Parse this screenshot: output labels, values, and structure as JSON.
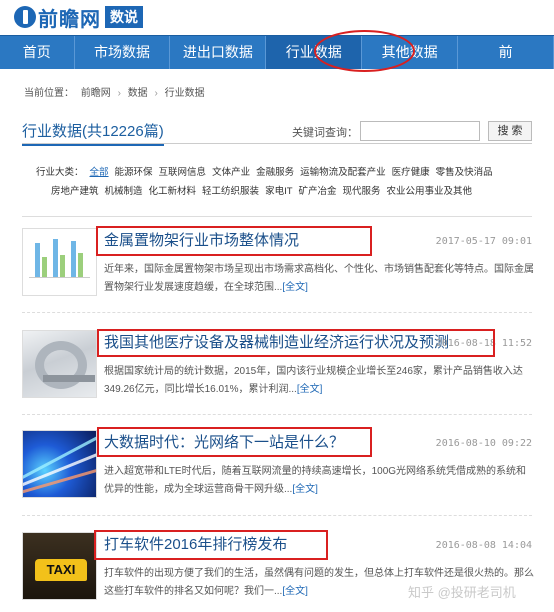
{
  "logo": {
    "name": "前瞻网",
    "badge": "数说"
  },
  "nav": [
    "首页",
    "市场数据",
    "进出口数据",
    "行业数据",
    "其他数据",
    "前"
  ],
  "breadcrumb": {
    "label": "当前位置：",
    "items": [
      "前瞻网",
      "数据",
      "行业数据"
    ]
  },
  "section": {
    "title": "行业数据(共12226篇)",
    "keyword_label": "关键词查询：",
    "search_value": "",
    "search_button": "搜 索"
  },
  "categories": {
    "label": "行业大类：",
    "row1": [
      "全部",
      "能源环保",
      "互联网信息",
      "文体产业",
      "金融服务",
      "运输物流及配套产业",
      "医疗健康",
      "零售及快消品"
    ],
    "row2": [
      "房地产建筑",
      "机械制造",
      "化工新材料",
      "轻工纺织服装",
      "家电IT",
      "矿产冶金",
      "现代服务",
      "农业公用事业及其他"
    ]
  },
  "articles": [
    {
      "title": "金属置物架行业市场整体情况",
      "date": "2017-05-17 09:01",
      "summary": "近年来，国际金属置物架市场呈现出市场需求高档化、个性化、市场销售配套化等特点。国际金属置物架行业发展速度趋缓，在全球范围...",
      "more": "[全文]",
      "thumb": "chart-thumbnail"
    },
    {
      "title": "我国其他医疗设备及器械制造业经济运行状况及预测",
      "date": "2016-08-18 11:52",
      "summary": "根据国家统计局的统计数据，2015年，国内该行业规模企业增长至246家，累计产品销售收入达349.26亿元，同比增长16.01%，累计利润...",
      "more": "[全文]",
      "thumb": "medical-equipment-thumbnail"
    },
    {
      "title": "大数据时代：光网络下一站是什么？",
      "date": "2016-08-10 09:22",
      "summary": "进入超宽带和LTE时代后，随着互联网流量的持续高速增长，100G光网络系统凭借成熟的系统和优异的性能，成为全球运营商骨干网升级...",
      "more": "[全文]",
      "thumb": "optical-fiber-thumbnail"
    },
    {
      "title": "打车软件2016年排行榜发布",
      "date": "2016-08-08 14:04",
      "summary": "打车软件的出现方便了我们的生活，虽然偶有问题的发生，但总体上打车软件还是很火热的。那么这些打车软件的排名又如何呢？我们一...",
      "more": "[全文]",
      "thumb": "taxi-thumbnail"
    }
  ],
  "thumb_text": {
    "taxi": "TAXI"
  },
  "watermark": "知乎 @投研老司机"
}
